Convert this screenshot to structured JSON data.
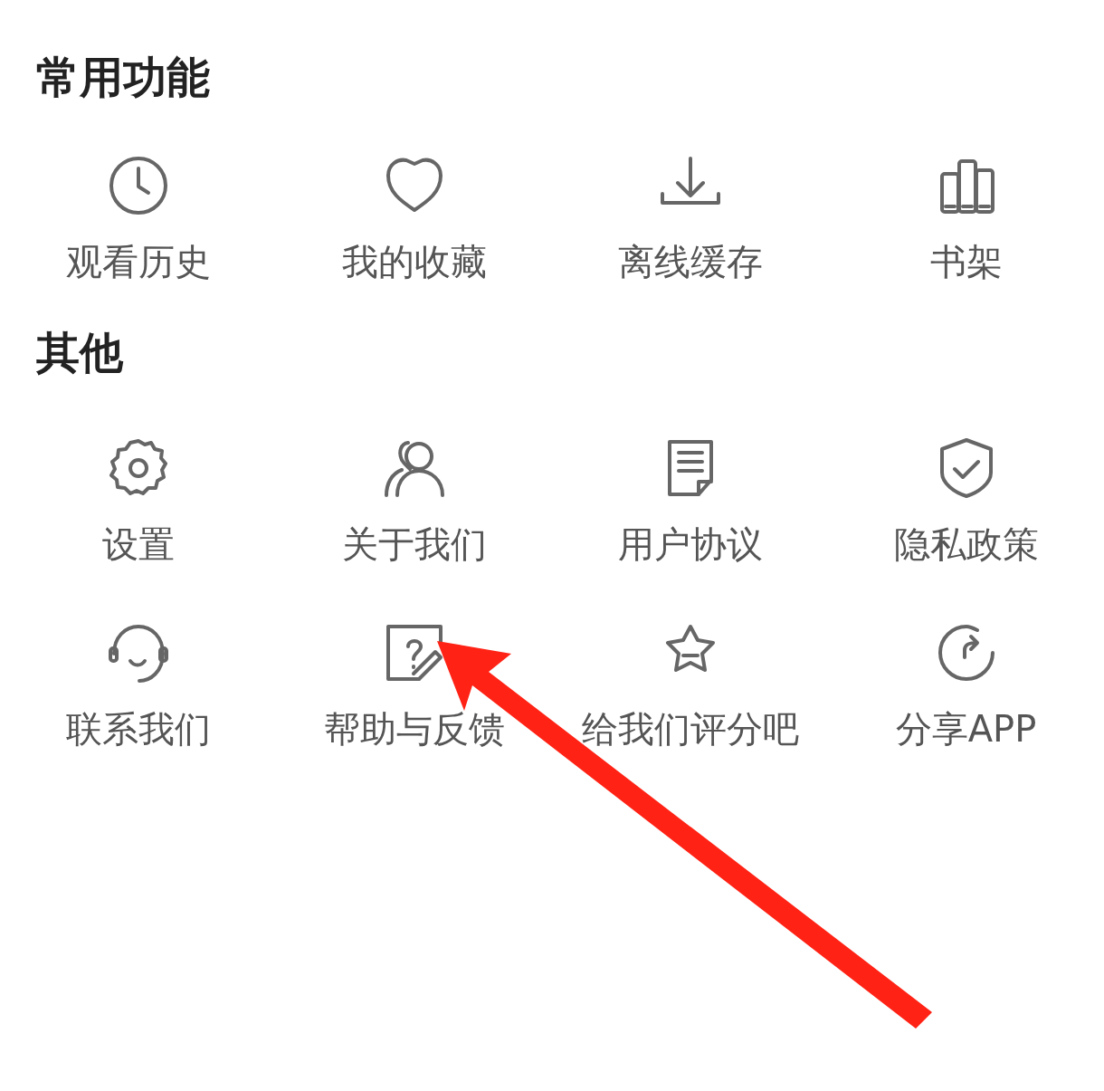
{
  "sections": [
    {
      "title": "常用功能",
      "items": [
        {
          "label": "观看历史"
        },
        {
          "label": "我的收藏"
        },
        {
          "label": "离线缓存"
        },
        {
          "label": "书架"
        }
      ]
    },
    {
      "title": "其他",
      "items": [
        {
          "label": "设置"
        },
        {
          "label": "关于我们"
        },
        {
          "label": "用户协议"
        },
        {
          "label": "隐私政策"
        },
        {
          "label": "联系我们"
        },
        {
          "label": "帮助与反馈"
        },
        {
          "label": "给我们评分吧"
        },
        {
          "label": "分享APP"
        }
      ]
    }
  ]
}
